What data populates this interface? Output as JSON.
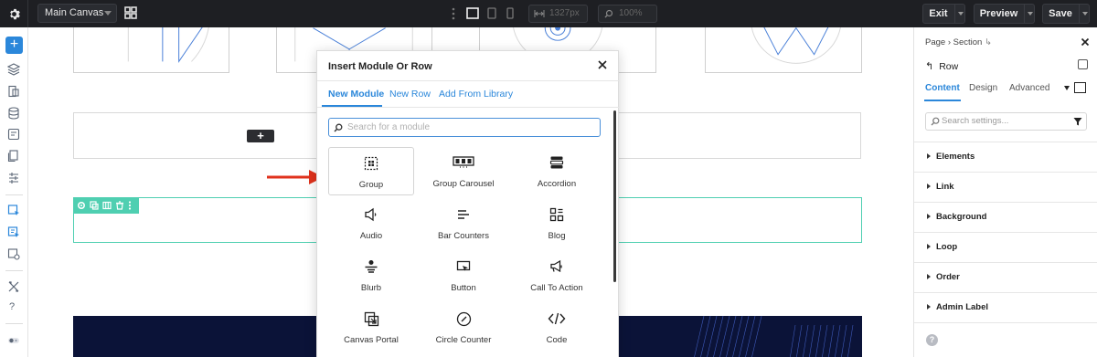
{
  "topbar": {
    "canvas_select": "Main Canvas",
    "width_field": "1327px",
    "zoom_field": "100%",
    "exit_label": "Exit",
    "preview_label": "Preview",
    "save_label": "Save"
  },
  "canvas": {
    "add_button": "+"
  },
  "modal": {
    "title": "Insert Module Or Row",
    "tabs": [
      {
        "label": "New Module",
        "active": true
      },
      {
        "label": "New Row",
        "active": false
      },
      {
        "label": "Add From Library",
        "active": false
      }
    ],
    "search_placeholder": "Search for a module",
    "modules": [
      {
        "label": "Group",
        "icon": "group-icon"
      },
      {
        "label": "Group Carousel",
        "icon": "group-carousel-icon"
      },
      {
        "label": "Accordion",
        "icon": "accordion-icon"
      },
      {
        "label": "Audio",
        "icon": "audio-icon"
      },
      {
        "label": "Bar Counters",
        "icon": "bar-counters-icon"
      },
      {
        "label": "Blog",
        "icon": "blog-icon"
      },
      {
        "label": "Blurb",
        "icon": "blurb-icon"
      },
      {
        "label": "Button",
        "icon": "button-icon"
      },
      {
        "label": "Call To Action",
        "icon": "call-to-action-icon"
      },
      {
        "label": "Canvas Portal",
        "icon": "canvas-portal-icon"
      },
      {
        "label": "Circle Counter",
        "icon": "circle-counter-icon"
      },
      {
        "label": "Code",
        "icon": "code-icon"
      }
    ]
  },
  "right_panel": {
    "breadcrumb": "Page › Section ↳",
    "breadcrumb_page": "Page",
    "breadcrumb_section": "Section",
    "title": "Row",
    "tabs": [
      "Content",
      "Design",
      "Advanced"
    ],
    "search_placeholder": "Search settings...",
    "sections": [
      "Elements",
      "Link",
      "Background",
      "Loop",
      "Order",
      "Admin Label"
    ],
    "help": "?"
  },
  "colors": {
    "accent": "#2b87da",
    "selection": "#4fcfb1",
    "topbar_bg": "#1e1f23",
    "arrow": "#e0321c"
  }
}
